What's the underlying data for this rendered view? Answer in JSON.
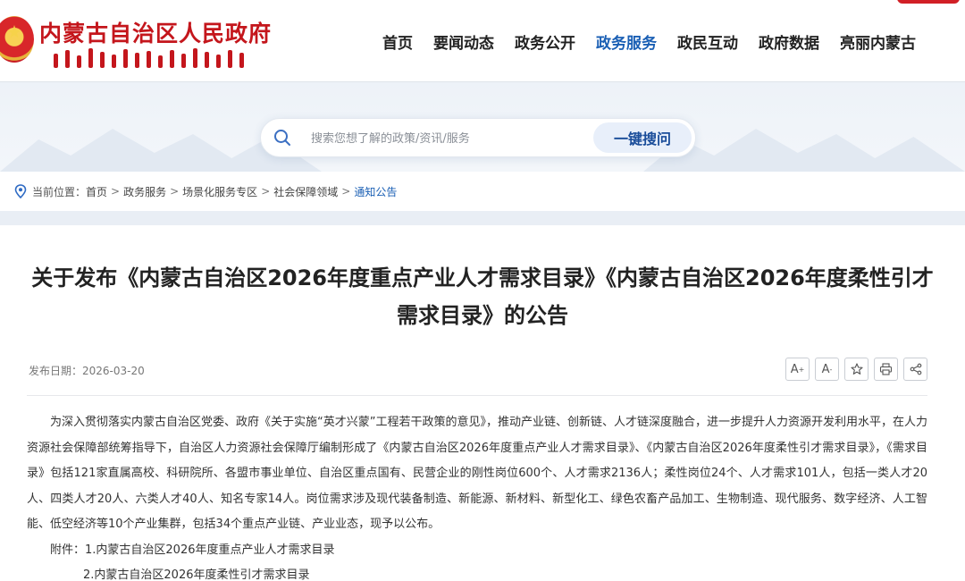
{
  "header": {
    "site_title": "内蒙古自治区人民政府",
    "nav": [
      {
        "label": "首页",
        "active": false
      },
      {
        "label": "要闻动态",
        "active": false
      },
      {
        "label": "政务公开",
        "active": false
      },
      {
        "label": "政务服务",
        "active": true
      },
      {
        "label": "政民互动",
        "active": false
      },
      {
        "label": "政府数据",
        "active": false
      },
      {
        "label": "亮丽内蒙古",
        "active": false
      }
    ],
    "accent_color": "#c4161c",
    "active_nav_color": "#1a5fb4"
  },
  "search": {
    "placeholder": "搜索您想了解的政策/资讯/服务",
    "button_label": "一键搜问",
    "icon": "search-icon"
  },
  "breadcrumb": {
    "prefix": "当前位置：",
    "items": [
      "首页",
      "政务服务",
      "场景化服务专区",
      "社会保障领域",
      "通知公告"
    ],
    "separator": ">",
    "icon": "location-pin-icon"
  },
  "article": {
    "title": "关于发布《内蒙古自治区2026年度重点产业人才需求目录》《内蒙古自治区2026年度柔性引才需求目录》的公告",
    "publish_date": "发布日期：2026-03-20",
    "tools": [
      {
        "name": "font-increase",
        "label": "A",
        "sup": "+"
      },
      {
        "name": "font-decrease",
        "label": "A",
        "sup": "-"
      },
      {
        "name": "favorite",
        "icon": "star-icon"
      },
      {
        "name": "print",
        "icon": "printer-icon"
      },
      {
        "name": "share",
        "icon": "share-icon"
      }
    ],
    "body": "为深入贯彻落实内蒙古自治区党委、政府《关于实施“英才兴蒙”工程若干政策的意见》，推动产业链、创新链、人才链深度融合，进一步提升人力资源开发利用水平，在人力资源社会保障部统筹指导下，自治区人力资源社会保障厅编制形成了《内蒙古自治区2026年度重点产业人才需求目录》、《内蒙古自治区2026年度柔性引才需求目录》，《需求目录》包括121家直属高校、科研院所、各盟市事业单位、自治区重点国有、民营企业的刚性岗位600个、人才需求2136人；柔性岗位24个、人才需求101人，包括一类人才20人、四类人才20人、六类人才40人、知名专家14人。岗位需求涉及现代装备制造、新能源、新材料、新型化工、绿色农畜产品加工、生物制造、现代服务、数字经济、人工智能、低空经济等10个产业集群，包括34个重点产业链、产业业态，现予以公布。",
    "attachment_1": "附件：1.内蒙古自治区2026年度重点产业人才需求目录",
    "attachment_2": "2.内蒙古自治区2026年度柔性引才需求目录"
  }
}
